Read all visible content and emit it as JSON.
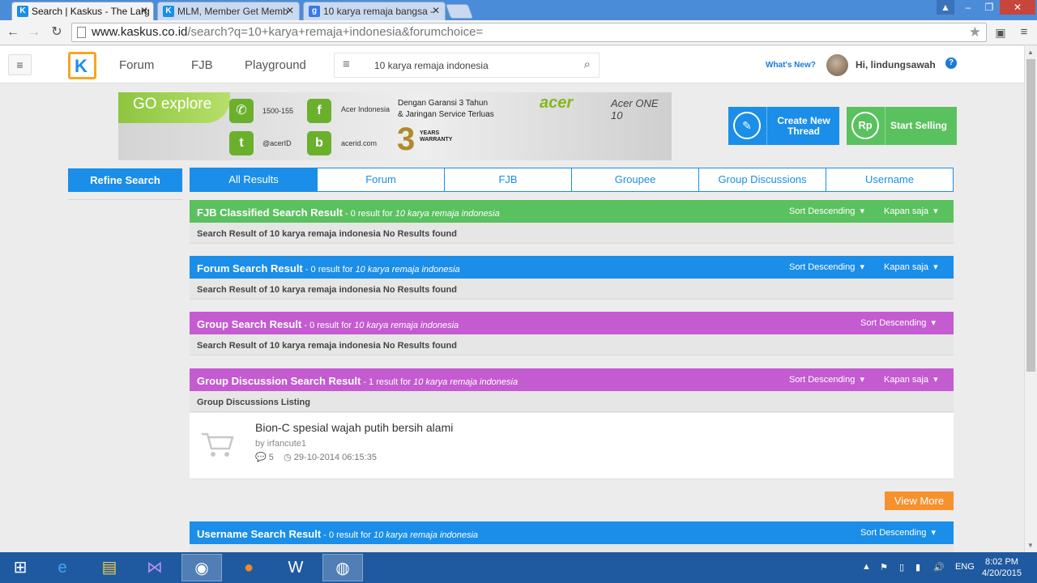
{
  "browser": {
    "tabs": [
      {
        "title": "Search | Kaskus - The Larg",
        "active": true
      },
      {
        "title": "MLM, Member Get Memb",
        "active": false
      },
      {
        "title": "10 karya remaja bangsa -",
        "active": false
      }
    ],
    "url_host": "www.kaskus.co.id",
    "url_path": "/search?q=10+karya+remaja+indonesia&forumchoice="
  },
  "header": {
    "nav": [
      "Forum",
      "FJB",
      "Playground"
    ],
    "search_query": "10 karya remaja indonesia",
    "whats_new": "What's New?",
    "greeting": "Hi, lindungsawah"
  },
  "banner": {
    "brand": "GO explore",
    "phone": "1500-155",
    "facebook": "Acer Indonesia",
    "twitter": "@acerID",
    "web": "acerid.com",
    "tagline1": "Dengan Garansi 3 Tahun",
    "tagline2": "& Jaringan Service Terluas",
    "three": "3",
    "years_warranty": "YEARS WARRANTY",
    "acer": "acer",
    "acer_one": "Acer ONE 10"
  },
  "actions": {
    "create_thread": "Create New Thread",
    "start_selling": "Start Selling"
  },
  "refine": "Refine Search",
  "search_tabs": [
    "All Results",
    "Forum",
    "FJB",
    "Groupee",
    "Group Discussions",
    "Username"
  ],
  "sections": {
    "fjb": {
      "title": "FJB Classified Search Result",
      "count": " - 0 result for ",
      "query": "10 karya remaja indonesia",
      "sort": "Sort Descending",
      "time": "Kapan saja",
      "body": "Search Result of 10 karya remaja indonesia No Results found"
    },
    "forum": {
      "title": "Forum Search Result",
      "count": " - 0 result for ",
      "query": "10 karya remaja indonesia",
      "sort": "Sort Descending",
      "time": "Kapan saja",
      "body": "Search Result of 10 karya remaja indonesia No Results found"
    },
    "group": {
      "title": "Group Search Result",
      "count": " - 0 result for ",
      "query": "10 karya remaja indonesia",
      "sort": "Sort Descending",
      "body": "Search Result of 10 karya remaja indonesia No Results found"
    },
    "group_discussion": {
      "title": "Group Discussion Search Result",
      "count": " - 1 result for ",
      "query": "10 karya remaja indonesia",
      "sort": "Sort Descending",
      "time": "Kapan saja",
      "body": "Group Discussions Listing",
      "item": {
        "title": "Bion-C spesial wajah putih bersih alami",
        "by": "by irfancute1",
        "comments": "5",
        "date": "29-10-2014 06:15:35"
      },
      "view_more": "View More"
    },
    "username": {
      "title": "Username Search Result",
      "count": " - 0 result for ",
      "query": "10 karya remaja indonesia",
      "sort": "Sort Descending"
    }
  },
  "taskbar": {
    "lang": "ENG",
    "time": "8:02 PM",
    "date": "4/20/2015"
  }
}
